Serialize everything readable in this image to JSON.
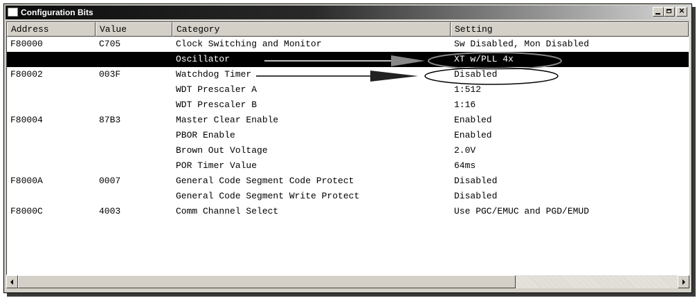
{
  "window": {
    "title": "Configuration Bits"
  },
  "columns": [
    "Address",
    "Value",
    "Category",
    "Setting"
  ],
  "rows": [
    {
      "address": "F80000",
      "value": "C705",
      "category": "Clock Switching and Monitor",
      "setting": "Sw Disabled, Mon Disabled",
      "selected": false
    },
    {
      "address": "",
      "value": "",
      "category": "Oscillator",
      "setting": "XT w/PLL 4x",
      "selected": true
    },
    {
      "address": "F80002",
      "value": "003F",
      "category": "Watchdog Timer",
      "setting": "Disabled",
      "selected": false
    },
    {
      "address": "",
      "value": "",
      "category": "WDT Prescaler A",
      "setting": "1:512",
      "selected": false
    },
    {
      "address": "",
      "value": "",
      "category": "WDT Prescaler B",
      "setting": "1:16",
      "selected": false
    },
    {
      "address": "F80004",
      "value": "87B3",
      "category": "Master Clear Enable",
      "setting": "Enabled",
      "selected": false
    },
    {
      "address": "",
      "value": "",
      "category": "PBOR Enable",
      "setting": "Enabled",
      "selected": false
    },
    {
      "address": "",
      "value": "",
      "category": "Brown Out Voltage",
      "setting": "2.0V",
      "selected": false
    },
    {
      "address": "",
      "value": "",
      "category": "POR Timer Value",
      "setting": "64ms",
      "selected": false
    },
    {
      "address": "F8000A",
      "value": "0007",
      "category": "General Code Segment Code Protect",
      "setting": "Disabled",
      "selected": false
    },
    {
      "address": "",
      "value": "",
      "category": "General Code Segment Write Protect",
      "setting": "Disabled",
      "selected": false
    },
    {
      "address": "F8000C",
      "value": "4003",
      "category": "Comm Channel Select",
      "setting": "Use PGC/EMUC and PGD/EMUD",
      "selected": false
    }
  ],
  "colors": {
    "selection": "#000000",
    "titlebar": "#0b0b0b",
    "face": "#d4d0c8"
  }
}
